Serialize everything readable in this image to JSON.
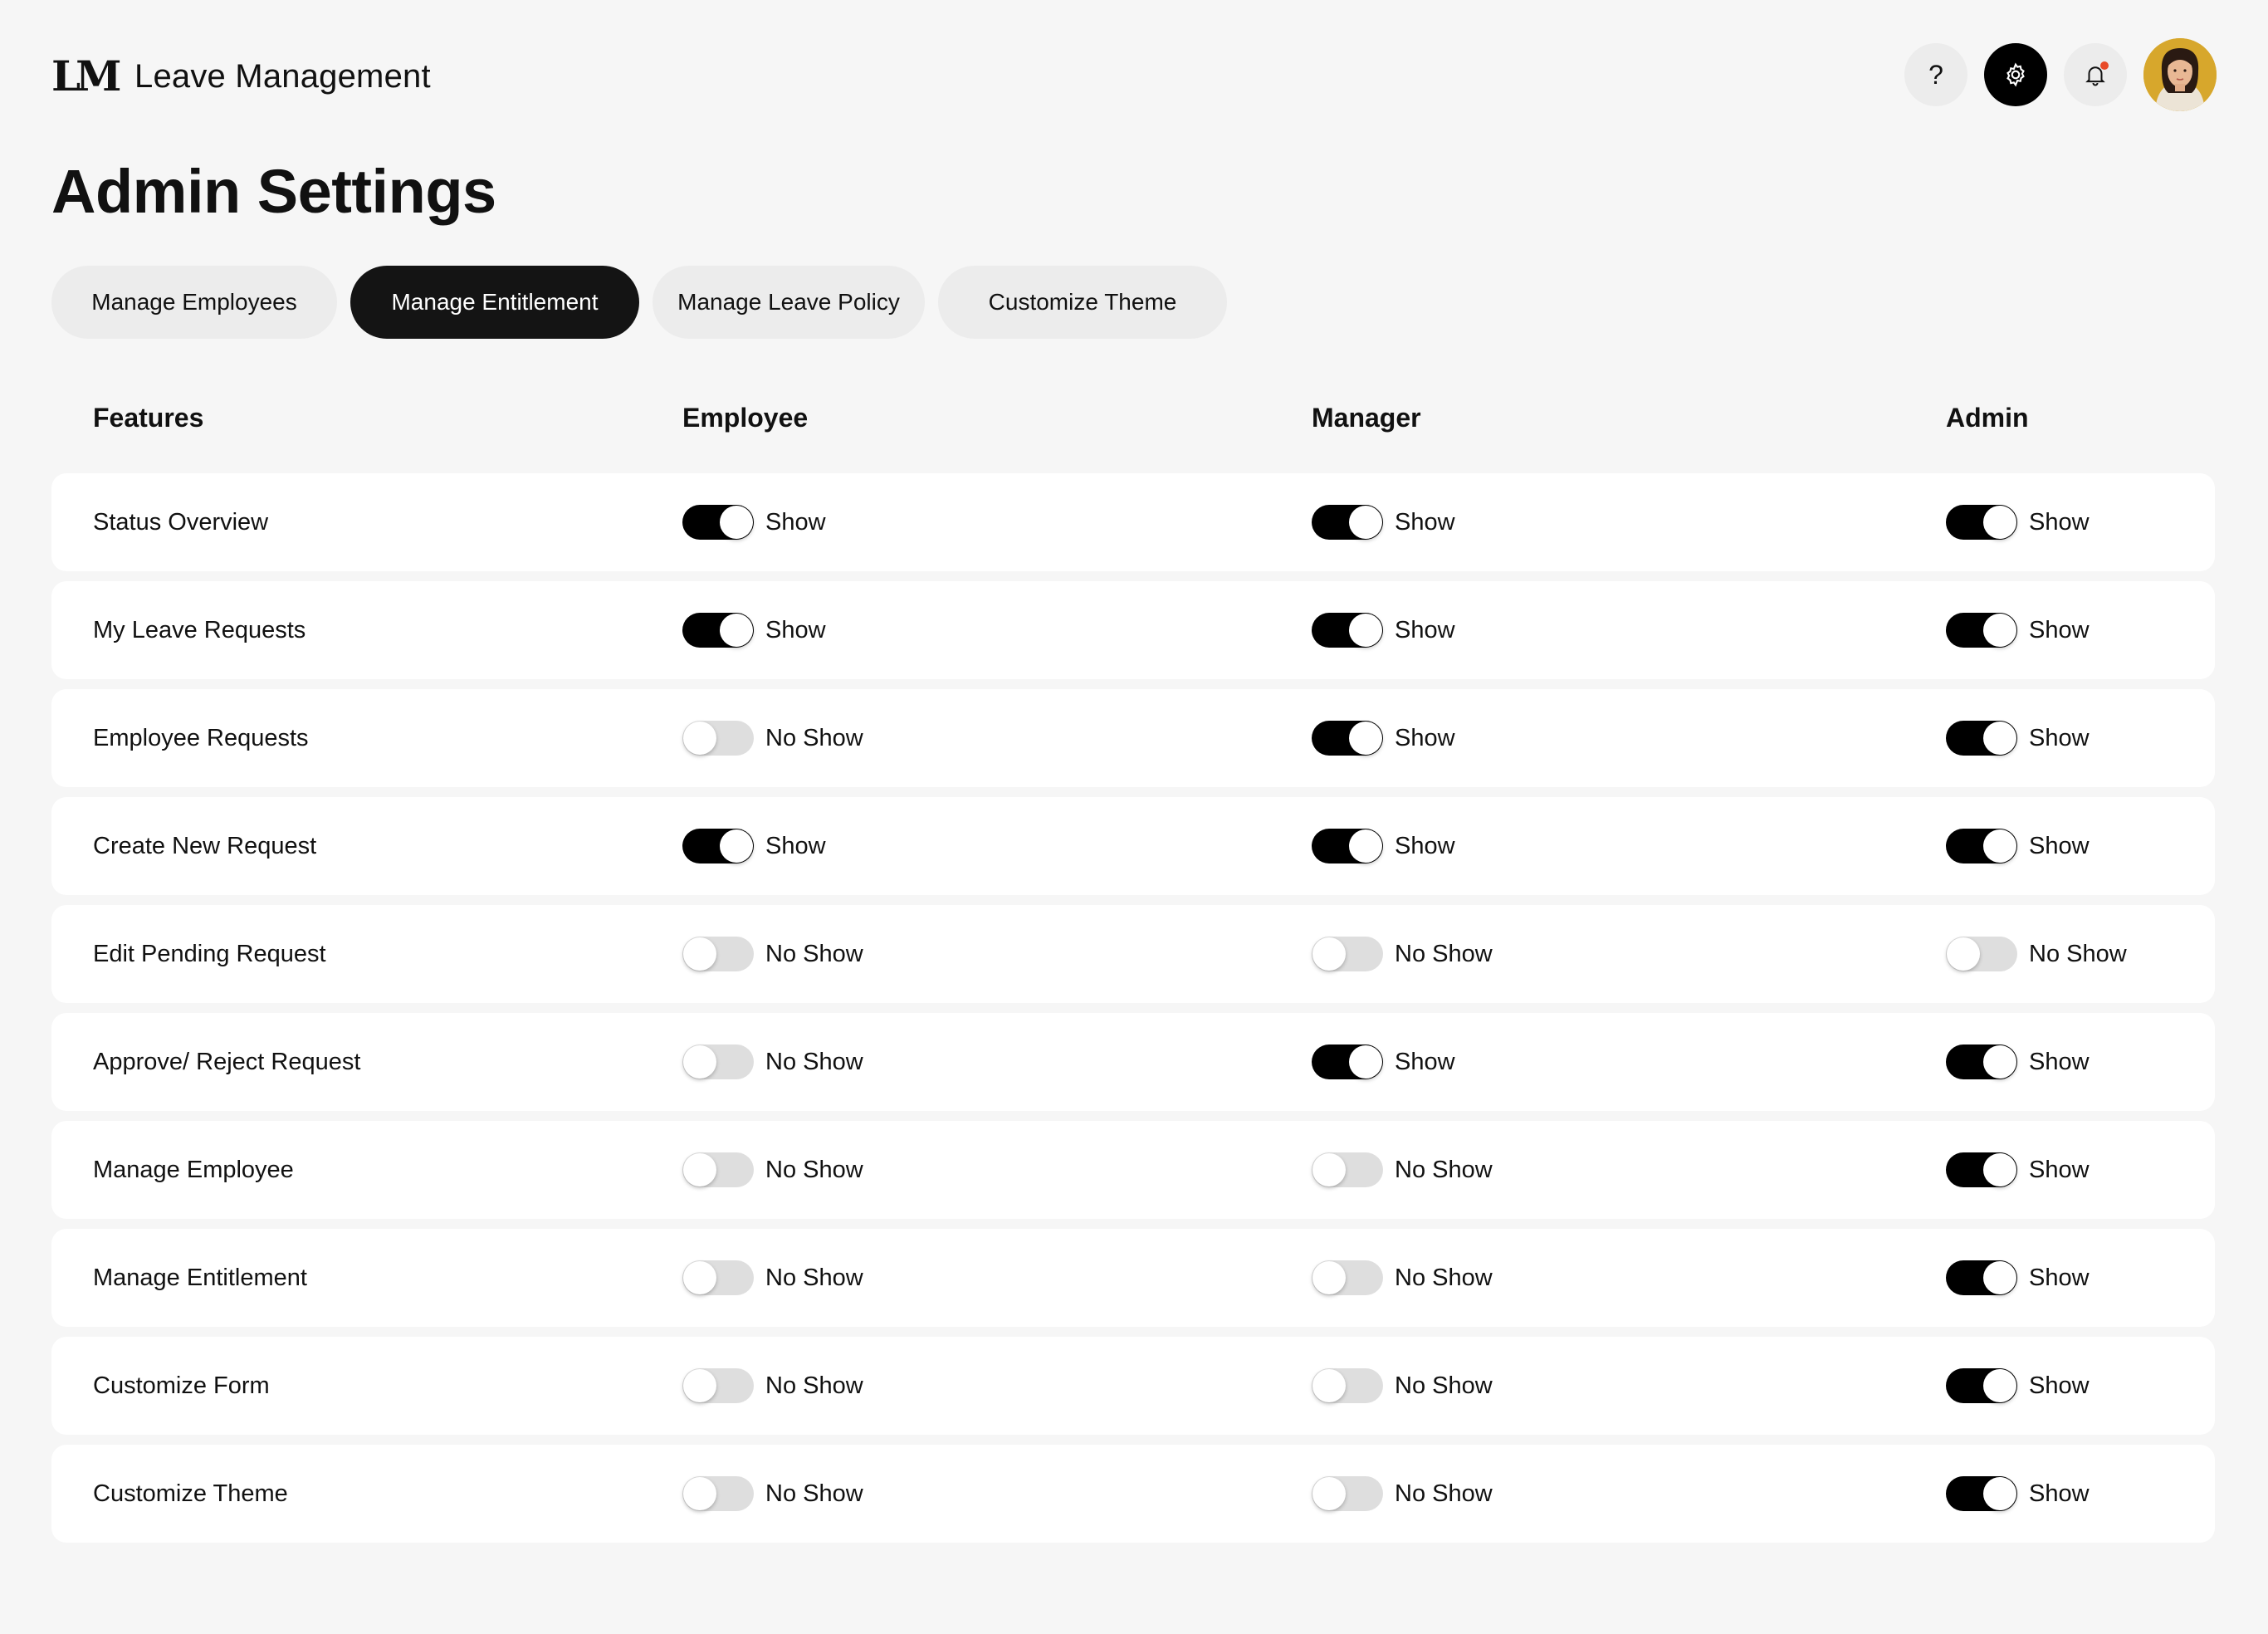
{
  "app": {
    "logo_text": "LM",
    "title": "Leave Management"
  },
  "header": {
    "icons": [
      "help-icon",
      "gear-icon",
      "bell-icon"
    ],
    "help_glyph": "?",
    "settings_glyph": "⚙",
    "notification_glyph": "🔔"
  },
  "page_title": "Admin Settings",
  "tabs": [
    {
      "label": "Manage Employees",
      "active": false
    },
    {
      "label": "Manage Entitlement",
      "active": true
    },
    {
      "label": "Manage Leave Policy",
      "active": false
    },
    {
      "label": "Customize Theme",
      "active": false
    }
  ],
  "table": {
    "headers": [
      "Features",
      "Employee",
      "Manager",
      "Admin"
    ],
    "rows": [
      {
        "feature": "Status Overview",
        "employee": "Show",
        "manager": "Show",
        "admin": "Show"
      },
      {
        "feature": "My Leave Requests",
        "employee": "Show",
        "manager": "Show",
        "admin": "Show"
      },
      {
        "feature": "Employee Requests",
        "employee": "No Show",
        "manager": "Show",
        "admin": "Show"
      },
      {
        "feature": "Create New Request",
        "employee": "Show",
        "manager": "Show",
        "admin": "Show"
      },
      {
        "feature": "Edit Pending Request",
        "employee": "No Show",
        "manager": "No Show",
        "admin": "No Show"
      },
      {
        "feature": "Approve/ Reject Request",
        "employee": "No Show",
        "manager": "Show",
        "admin": "Show"
      },
      {
        "feature": "Manage Employee",
        "employee": "No Show",
        "manager": "No Show",
        "admin": "Show"
      },
      {
        "feature": "Manage Entitlement",
        "employee": "No Show",
        "manager": "No Show",
        "admin": "Show"
      },
      {
        "feature": "Customize Form",
        "employee": "No Show",
        "manager": "No Show",
        "admin": "Show"
      },
      {
        "feature": "Customize Theme",
        "employee": "No Show",
        "manager": "No Show",
        "admin": "Show"
      }
    ]
  },
  "colors": {
    "background": "#f6f6f6",
    "row_background": "#ffffff",
    "accent": "#000000",
    "toggle_off": "#dedede",
    "notification_dot": "#e84a28"
  }
}
